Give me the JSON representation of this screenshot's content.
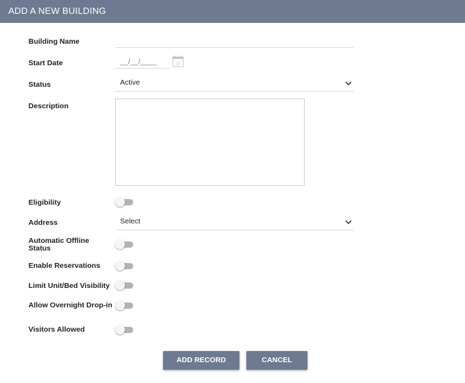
{
  "header": {
    "title": "ADD A NEW BUILDING"
  },
  "form": {
    "building_name": {
      "label": "Building Name",
      "value": ""
    },
    "start_date": {
      "label": "Start Date",
      "value": "__/__/____",
      "calendar_day": "25"
    },
    "status": {
      "label": "Status",
      "value": "Active"
    },
    "description": {
      "label": "Description",
      "value": ""
    },
    "eligibility": {
      "label": "Eligibility",
      "on": false
    },
    "address": {
      "label": "Address",
      "value": "Select"
    },
    "automatic_offline_status": {
      "label_line1": "Automatic Offline",
      "label_line2": "Status",
      "on": false
    },
    "enable_reservations": {
      "label": "Enable Reservations",
      "on": false
    },
    "limit_visibility": {
      "label": "Limit Unit/Bed Visibility",
      "on": false
    },
    "allow_overnight": {
      "label": "Allow Overnight Drop-in",
      "on": false
    },
    "visitors_allowed": {
      "label": "Visitors Allowed",
      "on": false
    }
  },
  "buttons": {
    "add_record": "ADD RECORD",
    "cancel": "CANCEL"
  },
  "icons": {
    "calendar": "calendar-icon",
    "chevron": "chevron-down-icon"
  },
  "colors": {
    "header": "#6d7a91",
    "button": "#6d7a91",
    "toggle_track": "#b3b3b3"
  }
}
